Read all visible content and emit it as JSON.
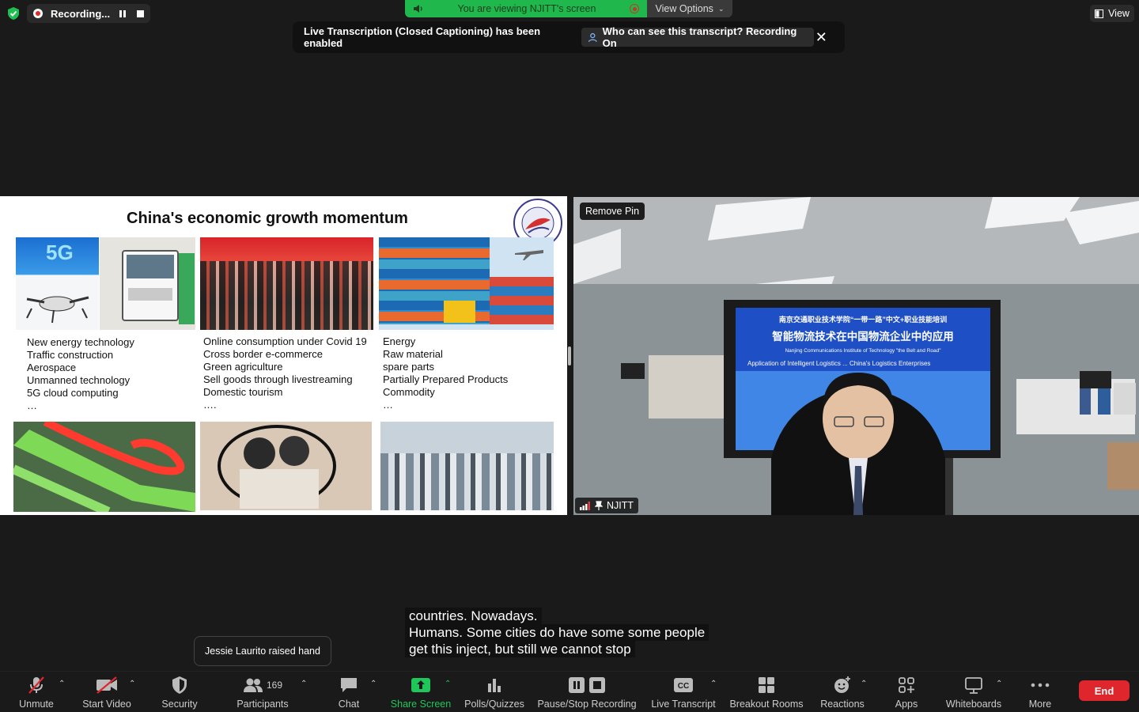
{
  "recording": {
    "label": "Recording..."
  },
  "viewing_bar": {
    "text": "You are viewing NJITT's screen",
    "view_options": "View Options"
  },
  "view_button": "View",
  "banner": {
    "message": "Live Transcription (Closed Captioning) has been enabled",
    "pill": "Who can see this transcript? Recording On"
  },
  "slide": {
    "title": "China's economic growth momentum",
    "columns": [
      [
        "New energy technology",
        "Traffic construction",
        "Aerospace",
        "Unmanned technology",
        "5G cloud computing",
        "…"
      ],
      [
        "Online consumption under Covid 19",
        "Cross border e-commerce",
        "Green agriculture",
        "Sell goods through livestreaming",
        "Domestic tourism",
        "…."
      ],
      [
        "Energy",
        "Raw material",
        "spare parts",
        "Partially Prepared Products",
        "Commodity",
        "…"
      ]
    ],
    "img_5g_text": "5G"
  },
  "video": {
    "remove_pin": "Remove Pin",
    "name": "NJITT",
    "screen_line1": "南京交通职业技术学院“一带一路”中文+职业技能培训",
    "screen_line2": "智能物流技术在中国物流企业中的应用",
    "screen_line3": "Nanjing Communications Institute of Technology \"the Belt and Road\"",
    "screen_line4": "Application of Intelligent Logistics ... China's Logistics Enterprises"
  },
  "captions": [
    "countries. Nowadays.",
    "Humans. Some cities do have some some people",
    "get this inject, but still we cannot stop"
  ],
  "raised_hand_tip": "Jessie Laurito raised hand",
  "toolbar": {
    "unmute": "Unmute",
    "start_video": "Start Video",
    "security": "Security",
    "participants": "Participants",
    "participants_count": "169",
    "chat": "Chat",
    "share_screen": "Share Screen",
    "polls": "Polls/Quizzes",
    "pause_stop": "Pause/Stop Recording",
    "live_transcript": "Live Transcript",
    "breakout": "Breakout Rooms",
    "reactions": "Reactions",
    "apps": "Apps",
    "whiteboards": "Whiteboards",
    "more": "More",
    "end": "End"
  },
  "colors": {
    "share_green": "#1fc75a",
    "end_red": "#e0262d",
    "viewing_green": "#20b84c"
  }
}
